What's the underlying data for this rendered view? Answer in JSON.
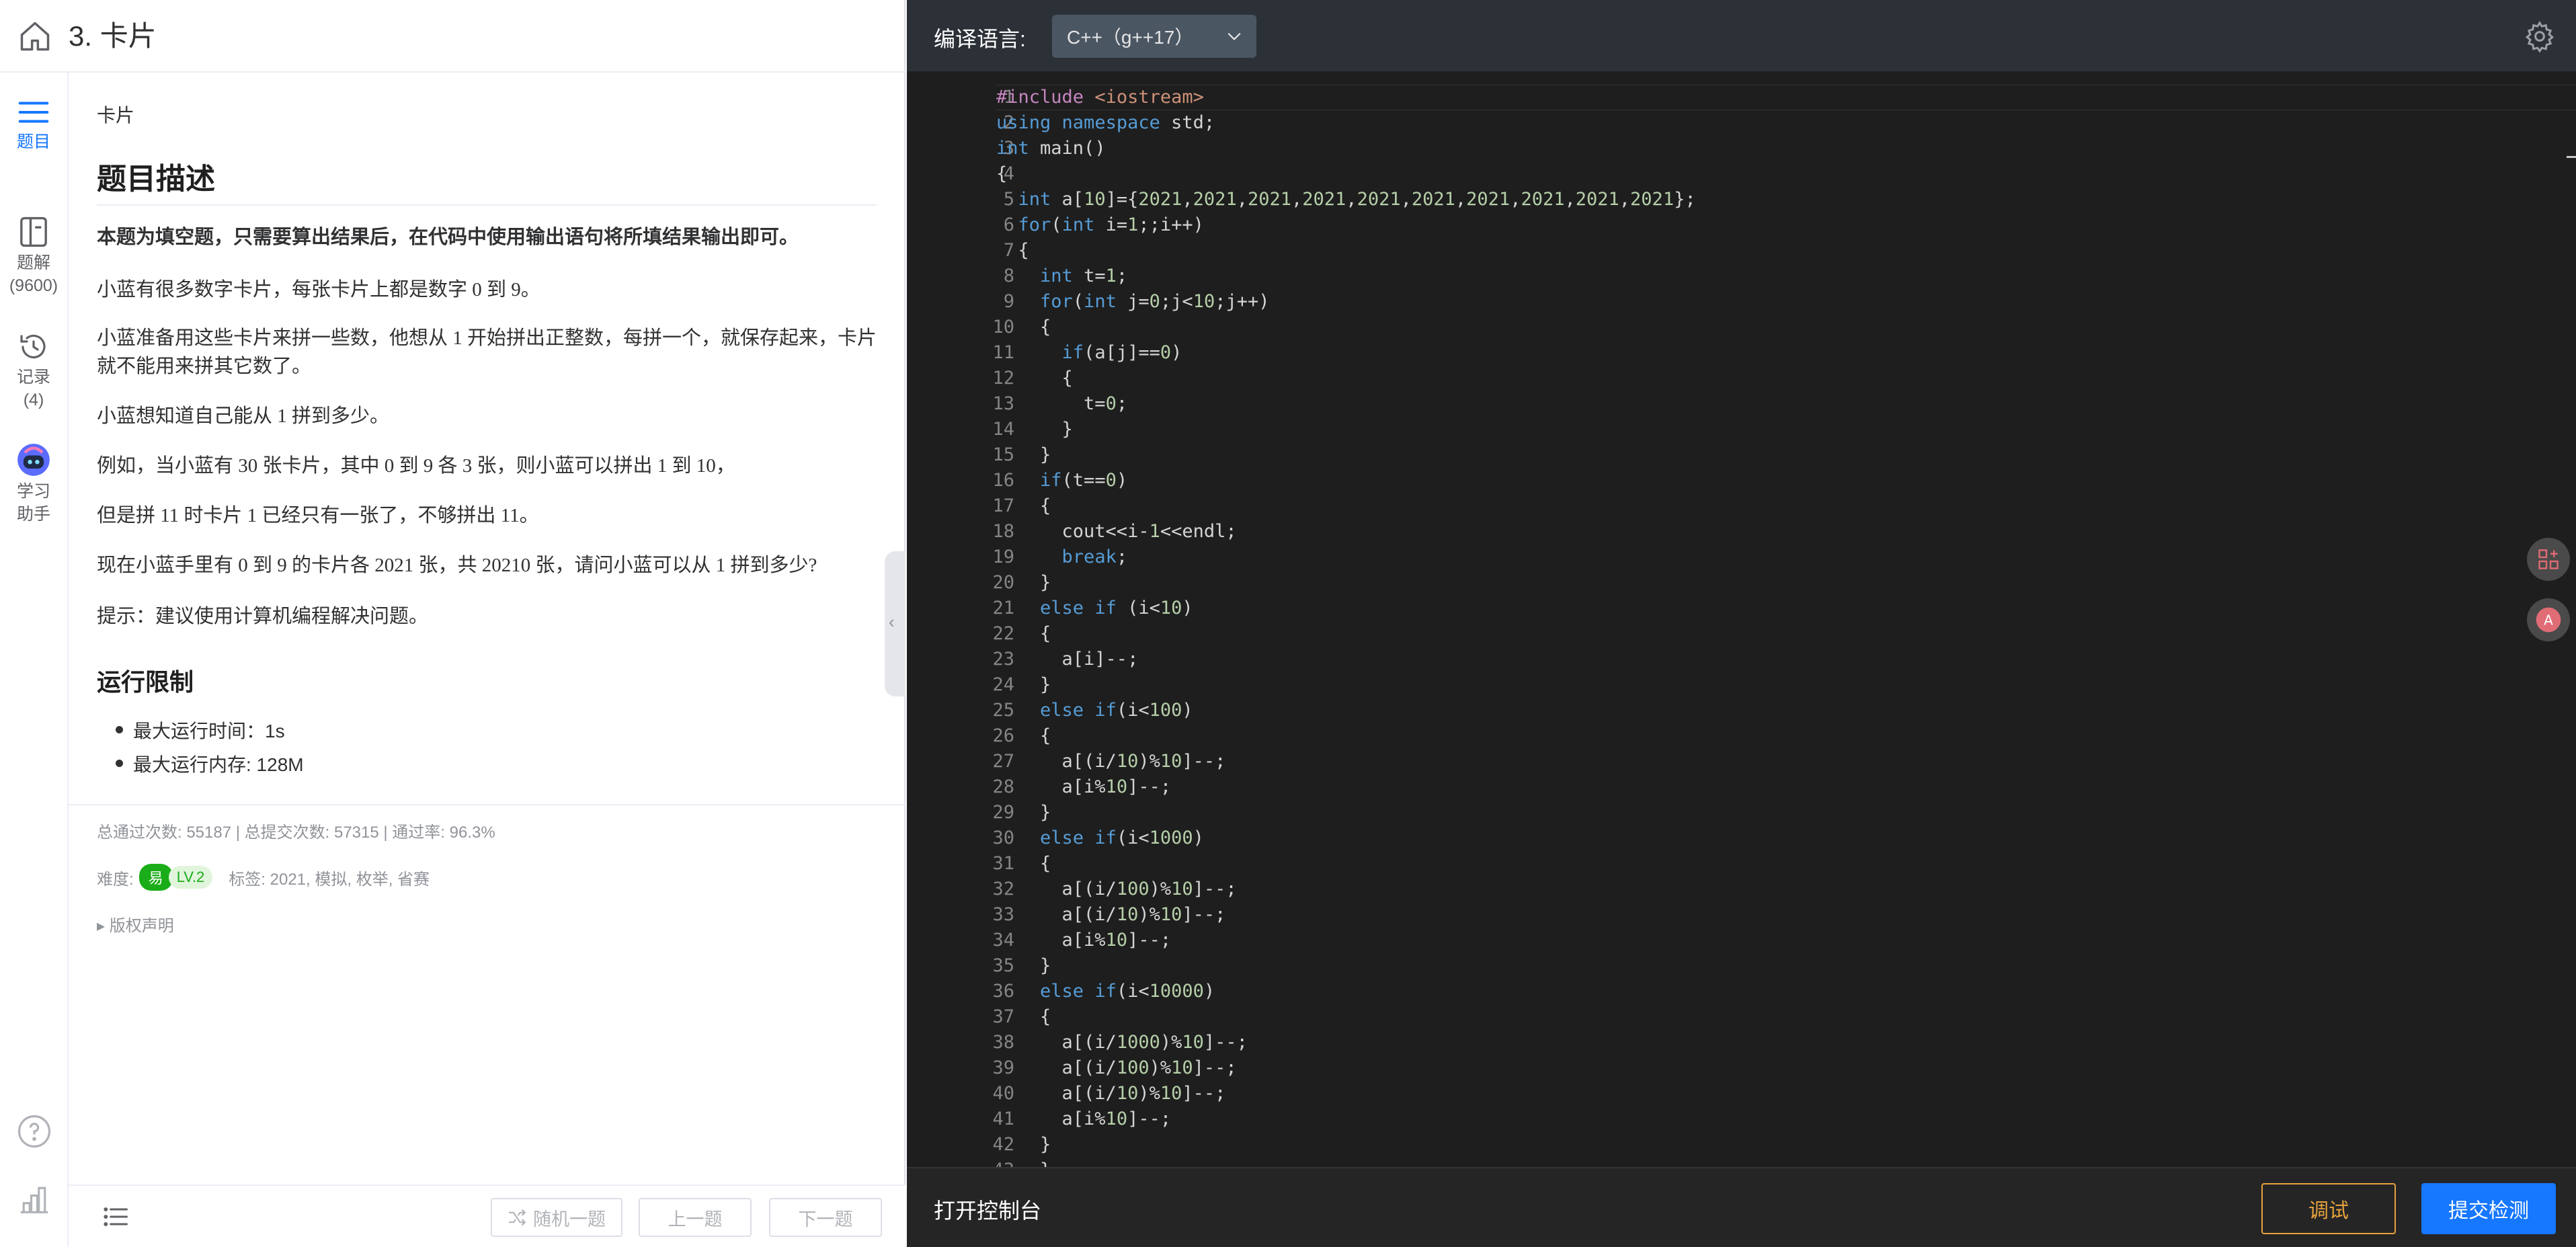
{
  "header": {
    "title": "3. 卡片",
    "home_icon": "home-icon"
  },
  "rail": {
    "items": [
      {
        "label": "题目",
        "sub": "",
        "icon": "list-icon",
        "active": true
      },
      {
        "label": "题解",
        "sub": "(9600)",
        "icon": "solution-icon",
        "active": false
      },
      {
        "label": "记录",
        "sub": "(4)",
        "icon": "history-icon",
        "active": false
      },
      {
        "label": "学习",
        "sub": "助手",
        "icon": "robot-icon",
        "active": false
      }
    ],
    "help_icon": "help-icon",
    "stats_icon": "stats-icon"
  },
  "problem": {
    "crumb": "卡片",
    "heading": "题目描述",
    "paragraphs": [
      "本题为填空题，只需要算出结果后，在代码中使用输出语句将所填结果输出即可。",
      "小蓝有很多数字卡片，每张卡片上都是数字 0 到 9。",
      "小蓝准备用这些卡片来拼一些数，他想从 1 开始拼出正整数，每拼一个，就保存起来，卡片就不能用来拼其它数了。",
      "小蓝想知道自己能从 1 拼到多少。",
      "例如，当小蓝有 30 张卡片，其中 0 到 9 各 3 张，则小蓝可以拼出 1 到 10，",
      "但是拼 11 时卡片 1 已经只有一张了，不够拼出 11。",
      "现在小蓝手里有 0 到 9 的卡片各 2021 张，共 20210 张，请问小蓝可以从 1 拼到多少?",
      "提示：建议使用计算机编程解决问题。"
    ],
    "limits_heading": "运行限制",
    "limits": [
      "最大运行时间：1s",
      "最大运行内存: 128M"
    ]
  },
  "meta": {
    "stats": "总通过次数: 55187  |  总提交次数: 57315  |  通过率: 96.3%",
    "difficulty_label": "难度:",
    "difficulty": "易",
    "level": "LV.2",
    "tags": "标签: 2021, 模拟, 枚举, 省赛",
    "copyright": "▸ 版权声明"
  },
  "pager": {
    "random": "随机一题",
    "prev": "上一题",
    "next": "下一题"
  },
  "editor": {
    "lang_label": "编译语言:",
    "lang_value": "C++（g++17）",
    "console": "打开控制台",
    "debug": "调试",
    "submit": "提交检测",
    "colors": {
      "accent": "#1677ff",
      "debug": "#e6a23c",
      "easy": "#1aad19"
    },
    "code": [
      "#include <iostream>",
      "using namespace std;",
      "int main()",
      "{",
      "  int a[10]={2021,2021,2021,2021,2021,2021,2021,2021,2021,2021};",
      "  for(int i=1;;i++)",
      "  {",
      "    int t=1;",
      "    for(int j=0;j<10;j++)",
      "    {",
      "      if(a[j]==0)",
      "      {",
      "        t=0;",
      "      }",
      "    }",
      "    if(t==0)",
      "    {",
      "      cout<<i-1<<endl;",
      "      break;",
      "    }",
      "    else if (i<10)",
      "    {",
      "      a[i]--;",
      "    }",
      "    else if(i<100)",
      "    {",
      "      a[(i/10)%10]--;",
      "      a[i%10]--;",
      "    }",
      "    else if(i<1000)",
      "    {",
      "      a[(i/100)%10]--;",
      "      a[(i/10)%10]--;",
      "      a[i%10]--;",
      "    }",
      "    else if(i<10000)",
      "    {",
      "      a[(i/1000)%10]--;",
      "      a[(i/100)%10]--;",
      "      a[(i/10)%10]--;",
      "      a[i%10]--;",
      "    }"
    ]
  }
}
